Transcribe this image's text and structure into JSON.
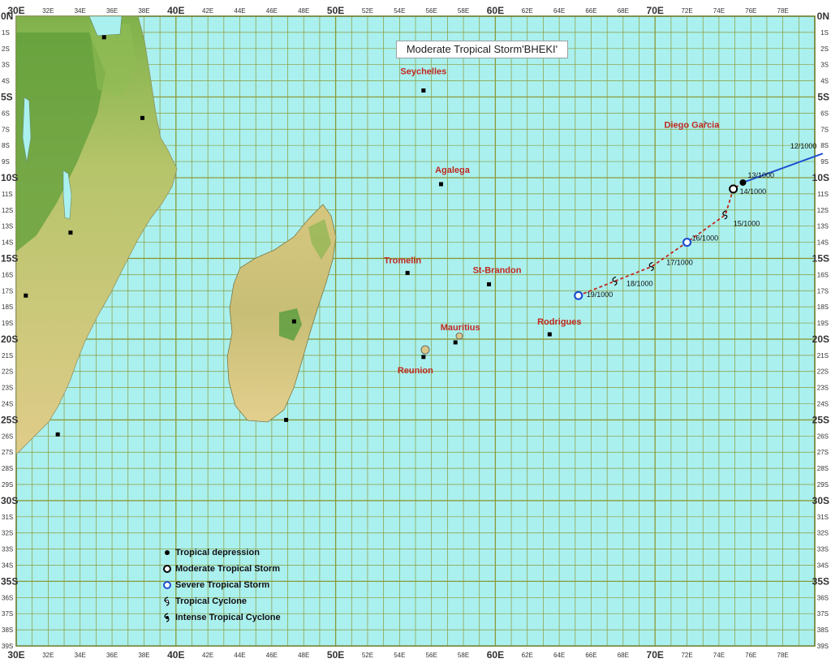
{
  "title": "Moderate Tropical Storm'BHEKI'",
  "axes": {
    "lon_major": [
      "30E",
      "40E",
      "50E",
      "60E",
      "70E"
    ],
    "lon_minor": [
      "32E",
      "34E",
      "36E",
      "38E",
      "42E",
      "44E",
      "46E",
      "48E",
      "52E",
      "54E",
      "56E",
      "58E",
      "62E",
      "64E",
      "66E",
      "68E",
      "72E",
      "74E",
      "76E",
      "78E"
    ],
    "lat_major": [
      "0N",
      "5S",
      "10S",
      "15S",
      "20S",
      "25S",
      "30S",
      "35S"
    ],
    "lat_minor": [
      "1S",
      "2S",
      "3S",
      "4S",
      "6S",
      "7S",
      "8S",
      "9S",
      "11S",
      "12S",
      "13S",
      "14S",
      "16S",
      "17S",
      "18S",
      "19S",
      "21S",
      "22S",
      "23S",
      "24S",
      "26S",
      "27S",
      "28S",
      "29S",
      "31S",
      "32S",
      "33S",
      "34S",
      "36S",
      "37S",
      "38S",
      "39S"
    ],
    "bottom_right": "39S"
  },
  "places": [
    {
      "name": "Seychelles",
      "lon": 55.5,
      "lat": -4.6
    },
    {
      "name": "Diego Garcia",
      "lon": 72.4,
      "lat": -7.3
    },
    {
      "name": "Agalega",
      "lon": 56.6,
      "lat": -10.4
    },
    {
      "name": "Tromelin",
      "lon": 54.5,
      "lat": -15.9
    },
    {
      "name": "St-Brandon",
      "lon": 59.6,
      "lat": -16.6
    },
    {
      "name": "Mauritius",
      "lon": 57.5,
      "lat": -20.2
    },
    {
      "name": "Rodrigues",
      "lon": 63.4,
      "lat": -19.7
    },
    {
      "name": "Reunion",
      "lon": 55.5,
      "lat": -21.1
    }
  ],
  "track": {
    "points": [
      {
        "label": "12/1000",
        "lon": 80.5,
        "lat": -8.5,
        "category": "Tropical depression"
      },
      {
        "label": "13/1000",
        "lon": 75.5,
        "lat": -10.3,
        "category": "Tropical depression"
      },
      {
        "label": "14/1000",
        "lon": 74.9,
        "lat": -10.7,
        "category": "Moderate Tropical Storm"
      },
      {
        "label": "15/1000",
        "lon": 74.4,
        "lat": -12.3,
        "category": "Tropical Cyclone"
      },
      {
        "label": "16/1000",
        "lon": 72.0,
        "lat": -14.0,
        "category": "Severe Tropical Storm"
      },
      {
        "label": "17/1000",
        "lon": 69.8,
        "lat": -15.5,
        "category": "Tropical Cyclone"
      },
      {
        "label": "18/1000",
        "lon": 67.5,
        "lat": -16.4,
        "category": "Tropical Cyclone"
      },
      {
        "label": "19/1000",
        "lon": 65.2,
        "lat": -17.3,
        "category": "Severe Tropical Storm"
      }
    ],
    "observed_color": "#1f4fd1",
    "forecast_color": "#c0281e"
  },
  "legend": [
    {
      "label": "Tropical depression",
      "symbol": "dot"
    },
    {
      "label": "Moderate Tropical Storm",
      "symbol": "ring-black"
    },
    {
      "label": "Severe Tropical Storm",
      "symbol": "ring-blue"
    },
    {
      "label": "Tropical Cyclone",
      "symbol": "cyclone"
    },
    {
      "label": "Intense Tropical Cyclone",
      "symbol": "cyclone-filled"
    }
  ],
  "colors": {
    "ocean": "#aaf0ee",
    "grid": "#8a9a3a",
    "land": "#d9c88a",
    "land_green": "#7cae4a",
    "label": "#c0281e"
  }
}
